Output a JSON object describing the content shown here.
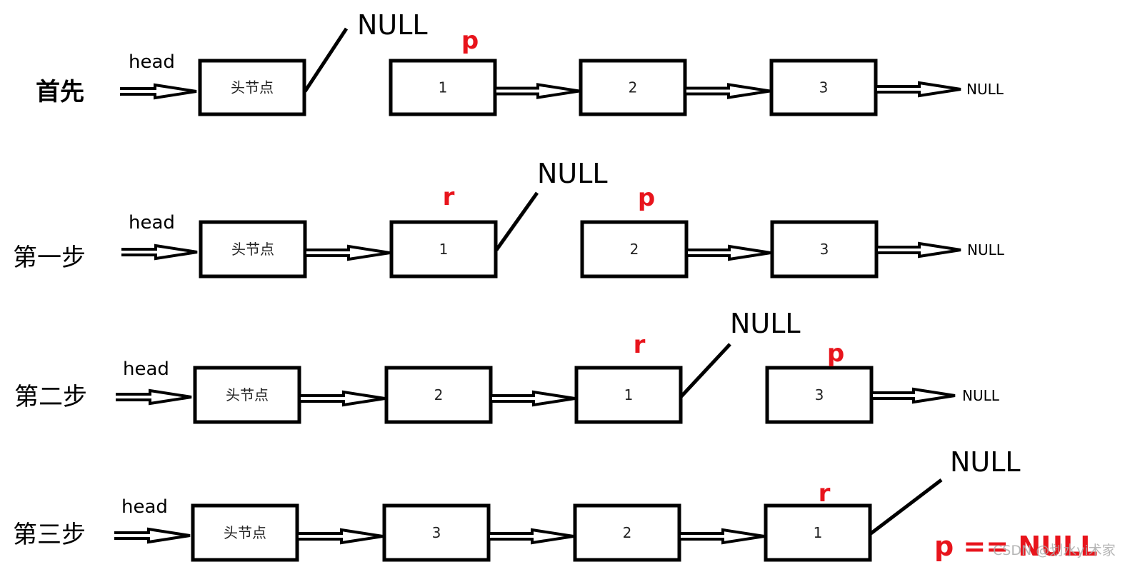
{
  "rows": [
    {
      "label": "首先",
      "head": "head",
      "nodes": [
        "头节点",
        "1",
        "2",
        "3"
      ],
      "tail_null": "NULL",
      "null_pointer": "NULL",
      "pointers": [
        {
          "name": "p",
          "at": 1
        }
      ]
    },
    {
      "label": "第一步",
      "head": "head",
      "nodes": [
        "头节点",
        "1",
        "2",
        "3"
      ],
      "tail_null": "NULL",
      "null_pointer": "NULL",
      "pointers": [
        {
          "name": "r",
          "at": 1
        },
        {
          "name": "p",
          "at": 2
        }
      ]
    },
    {
      "label": "第二步",
      "head": "head",
      "nodes": [
        "头节点",
        "2",
        "1",
        "3"
      ],
      "tail_null": "NULL",
      "null_pointer": "NULL",
      "pointers": [
        {
          "name": "r",
          "at": 2
        },
        {
          "name": "p",
          "at": 3
        }
      ]
    },
    {
      "label": "第三步",
      "head": "head",
      "nodes": [
        "头节点",
        "3",
        "2",
        "1"
      ],
      "tail_null": "",
      "null_pointer": "NULL",
      "pointers": [
        {
          "name": "r",
          "at": 3
        }
      ]
    }
  ],
  "final_condition": "p == NULL",
  "watermark": "CSDN @划水yi术家",
  "colors": {
    "pointer": "#e8141c",
    "line": "#000000"
  }
}
